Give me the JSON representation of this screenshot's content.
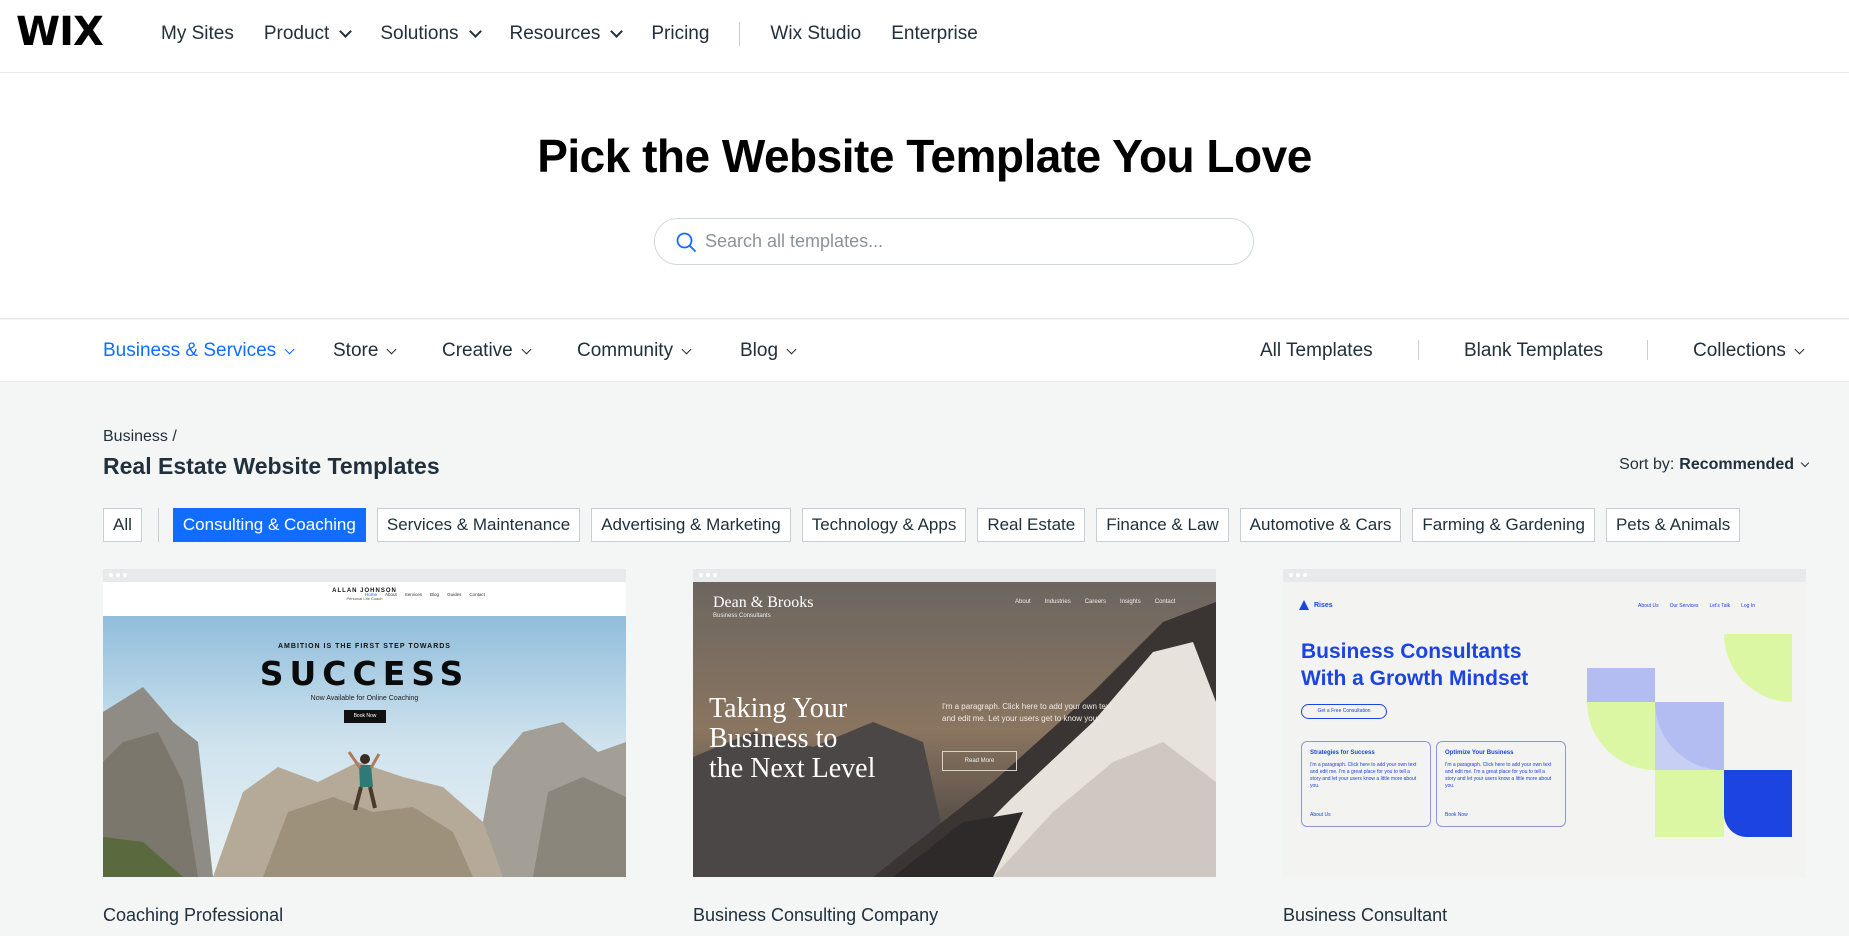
{
  "nav": {
    "logo": "WIX",
    "items": [
      {
        "label": "My Sites",
        "dropdown": false
      },
      {
        "label": "Product",
        "dropdown": true
      },
      {
        "label": "Solutions",
        "dropdown": true
      },
      {
        "label": "Resources",
        "dropdown": true
      },
      {
        "label": "Pricing",
        "dropdown": false
      }
    ],
    "secondary": [
      {
        "label": "Wix Studio"
      },
      {
        "label": "Enterprise"
      }
    ]
  },
  "hero": {
    "title": "Pick the Website Template You Love",
    "search_placeholder": "Search all templates..."
  },
  "categories": {
    "left": [
      {
        "label": "Business & Services",
        "active": true
      },
      {
        "label": "Store",
        "active": false
      },
      {
        "label": "Creative",
        "active": false
      },
      {
        "label": "Community",
        "active": false
      },
      {
        "label": "Blog",
        "active": false
      }
    ],
    "right": {
      "all": "All Templates",
      "blank": "Blank Templates",
      "collections": "Collections"
    }
  },
  "content": {
    "breadcrumb": "Business /",
    "title": "Real Estate Website Templates",
    "sort_label": "Sort by:",
    "sort_value": "Recommended",
    "chip_all": "All",
    "chips": [
      {
        "label": "Consulting & Coaching",
        "active": true
      },
      {
        "label": "Services & Maintenance",
        "active": false
      },
      {
        "label": "Advertising & Marketing",
        "active": false
      },
      {
        "label": "Technology & Apps",
        "active": false
      },
      {
        "label": "Real Estate",
        "active": false
      },
      {
        "label": "Finance & Law",
        "active": false
      },
      {
        "label": "Automotive & Cars",
        "active": false
      },
      {
        "label": "Farming & Gardening",
        "active": false
      },
      {
        "label": "Pets & Animals",
        "active": false
      }
    ]
  },
  "cards": [
    {
      "name": "Coaching Professional",
      "preview": {
        "brand": "ALLAN JOHNSON",
        "brand_sub": "Personal Life Coach",
        "menu": [
          "Home",
          "About",
          "Services",
          "Blog",
          "Guides",
          "Contact"
        ],
        "kicker": "AMBITION IS THE FIRST STEP TOWARDS",
        "headline": "SUCCESS",
        "sub": "Now Available for Online Coaching",
        "cta": "Book Now"
      }
    },
    {
      "name": "Business Consulting Company",
      "preview": {
        "brand": "Dean & Brooks",
        "brand_sub": "Business Consultants",
        "menu": [
          "About",
          "Industries",
          "Careers",
          "Insights",
          "Contact"
        ],
        "headline_lines": [
          "Taking Your",
          "Business to",
          "the Next Level"
        ],
        "paragraph": "I'm a paragraph. Click here to add your own text and edit me. Let your users get to know you.",
        "cta": "Read More"
      }
    },
    {
      "name": "Business Consultant",
      "preview": {
        "brand": "Rises",
        "menu": [
          "About Us",
          "Our Services",
          "Let's Talk",
          "Log In"
        ],
        "headline_lines": [
          "Business Consultants",
          "With a Growth Mindset"
        ],
        "cta": "Get a Free Consultation",
        "box1_title": "Strategies for Success",
        "box1_text": "I'm a paragraph. Click here to add your own text and edit me. I'm a great place for you to tell a story and let your users know a little more about you.",
        "box1_link": "About Us",
        "box2_title": "Optimize Your Business",
        "box2_text": "I'm a paragraph. Click here to add your own text and edit me. I'm a great place for you to tell a story and let your users know a little more about you.",
        "box2_link": "Book Now"
      }
    }
  ],
  "colors": {
    "accent": "#116dff",
    "text": "#20303c",
    "page_bg": "#f4f5f5",
    "rises_blue": "#1b44e0",
    "rises_lime": "#dcf7a3",
    "rises_lavender": "#b3bdf2"
  }
}
